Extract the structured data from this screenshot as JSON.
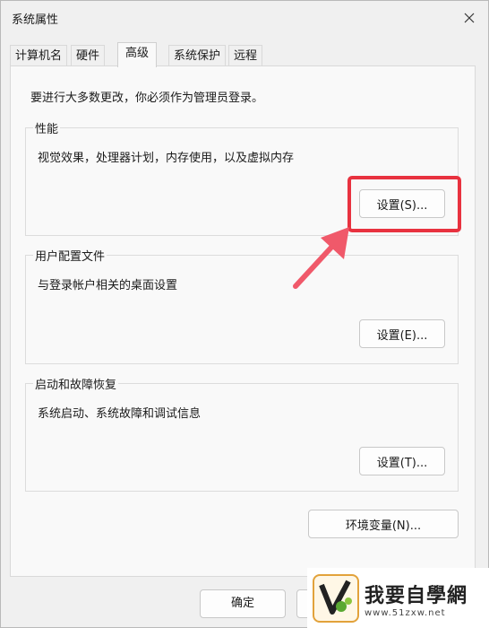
{
  "window": {
    "title": "系统属性"
  },
  "tabs": [
    {
      "label": "计算机名",
      "active": false
    },
    {
      "label": "硬件",
      "active": false
    },
    {
      "label": "高级",
      "active": true
    },
    {
      "label": "系统保护",
      "active": false
    },
    {
      "label": "远程",
      "active": false
    }
  ],
  "notice": "要进行大多数更改，你必须作为管理员登录。",
  "groups": {
    "performance": {
      "title": "性能",
      "description": "视觉效果，处理器计划，内存使用，以及虚拟内存",
      "button": "设置(S)..."
    },
    "profiles": {
      "title": "用户配置文件",
      "description": "与登录帐户相关的桌面设置",
      "button": "设置(E)..."
    },
    "startup": {
      "title": "启动和故障恢复",
      "description": "系统启动、系统故障和调试信息",
      "button": "设置(T)..."
    }
  },
  "env_button": "环境变量(N)...",
  "footer": {
    "ok": "确定",
    "cancel": "",
    "apply": ""
  },
  "watermark": {
    "brand": "我要自學網",
    "url": "www.51zxw.net"
  },
  "colors": {
    "highlight": "#e8323f",
    "panel": "#f9f9f9",
    "window": "#f0f0f0"
  },
  "icons": {
    "close": "close-icon",
    "arrow": "arrow-icon"
  }
}
